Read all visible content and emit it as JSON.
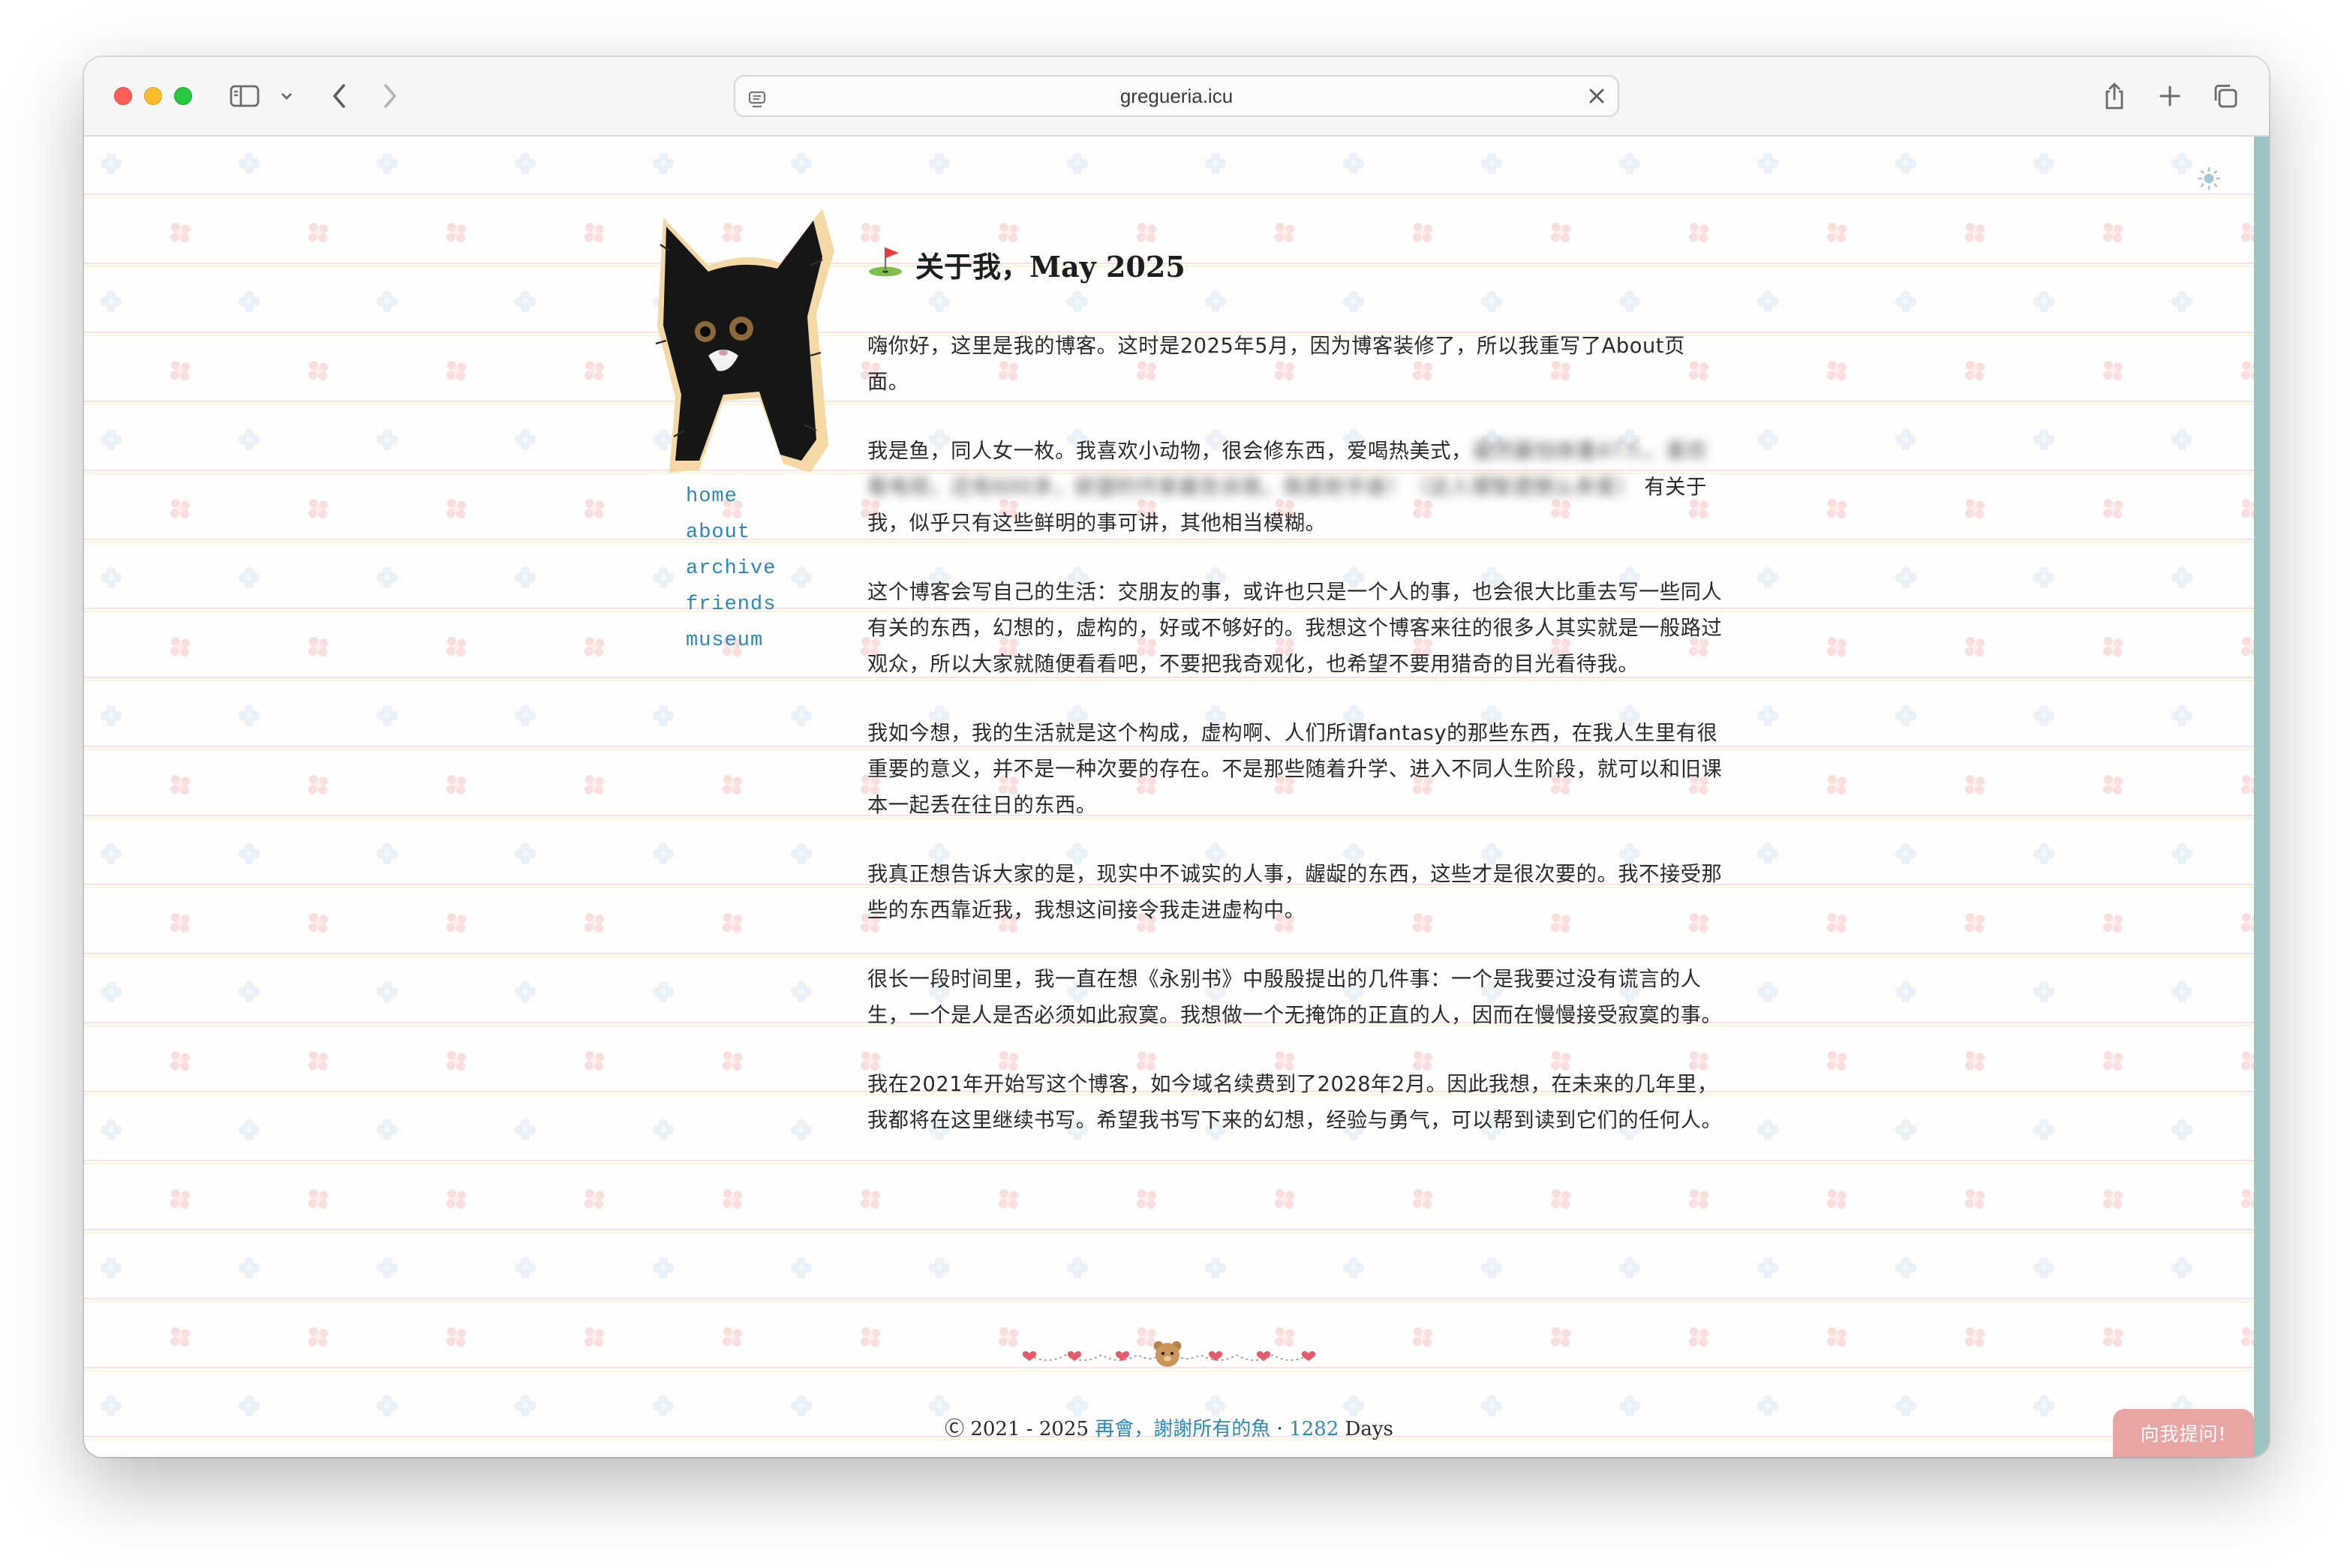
{
  "browser": {
    "url": "gregueria.icu",
    "icons": [
      "sidebar-icon",
      "chevron-down-icon",
      "back-icon",
      "forward-icon",
      "page-icon",
      "clear-icon",
      "share-icon",
      "new-tab-icon",
      "tabs-overview-icon"
    ]
  },
  "theme": {
    "accent": "#2a8ab6",
    "scrollbar": "#9cc2c1",
    "ask_button": "#e9a4a4"
  },
  "nav": [
    {
      "label": "home"
    },
    {
      "label": "about"
    },
    {
      "label": "archive"
    },
    {
      "label": "friends"
    },
    {
      "label": "museum"
    }
  ],
  "post": {
    "title": "关于我，May 2025",
    "paragraphs": {
      "p1": "嗨你好，这里是我的博客。这时是2025年5月，因为博客装修了，所以我重写了About页面。",
      "p2_visible": "我是鱼，同人女一枚。我喜欢小动物，很会修东西，爱喝热美式，",
      "p2_blurred": "虽然最怕体重47人，喜欢看电视，还有600多，欲望的作家最告诉我，我是射手座！（这人理智遗憾么亲爱）",
      "p2_tail": "有关于我，似乎只有这些鲜明的事可讲，其他相当模糊。",
      "p3": "这个博客会写自己的生活：交朋友的事，或许也只是一个人的事，也会很大比重去写一些同人有关的东西，幻想的，虚构的，好或不够好的。我想这个博客来往的很多人其实就是一般路过观众，所以大家就随便看看吧，不要把我奇观化，也希望不要用猎奇的目光看待我。",
      "p4": "我如今想，我的生活就是这个构成，虚构啊、人们所谓fantasy的那些东西，在我人生里有很重要的意义，并不是一种次要的存在。不是那些随着升学、进入不同人生阶段，就可以和旧课本一起丢在往日的东西。",
      "p5": "我真正想告诉大家的是，现实中不诚实的人事，龌龊的东西，这些才是很次要的。我不接受那些的东西靠近我，我想这间接令我走进虚构中。",
      "p6": "很长一段时间里，我一直在想《永别书》中殷殷提出的几件事：一个是我要过没有谎言的人生，一个是人是否必须如此寂寞。我想做一个无掩饰的正直的人，因而在慢慢接受寂寞的事。",
      "p7": "我在2021年开始写这个博客，如今域名续费到了2028年2月。因此我想，在未来的几年里，我都将在这里继续书写。希望我书写下来的幻想，经验与勇气，可以帮到读到它们的任何人。"
    }
  },
  "footer": {
    "copyright": "Ⓒ 2021 - 2025",
    "motto": "再會，謝謝所有的魚",
    "separator": "·",
    "days": "1282",
    "days_label": "Days"
  },
  "ask_button": "向我提问!"
}
